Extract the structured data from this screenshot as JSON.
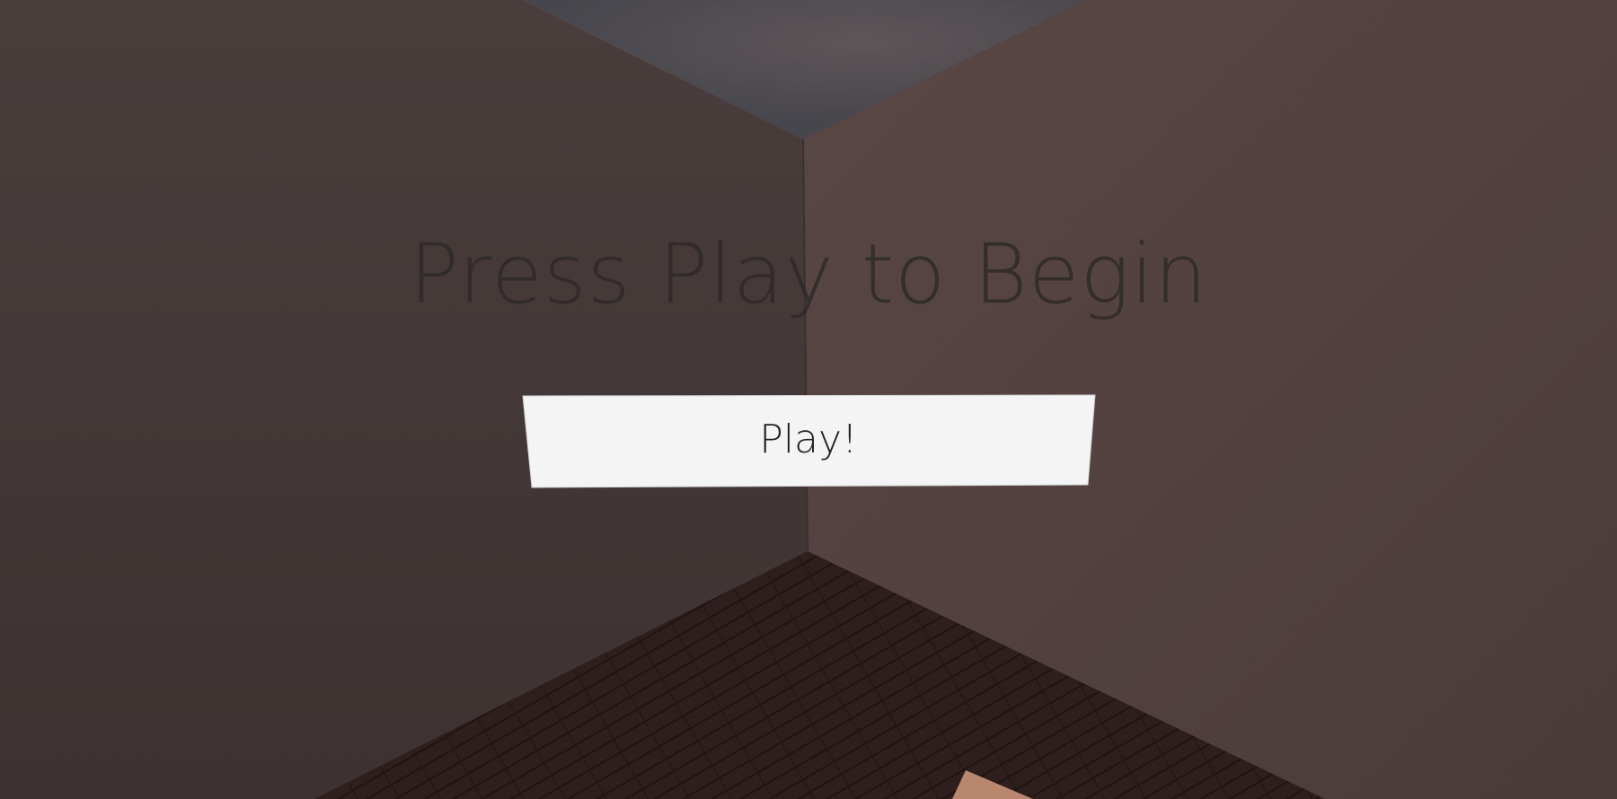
{
  "menu": {
    "title": "Press Play to Begin",
    "play_label": "Play!"
  },
  "colors": {
    "left_wall": "#463a39",
    "right_wall": "#524341",
    "floor": "#2e1f1e",
    "sky": "#4c4b50",
    "button_bg": "#f4f4f4"
  }
}
